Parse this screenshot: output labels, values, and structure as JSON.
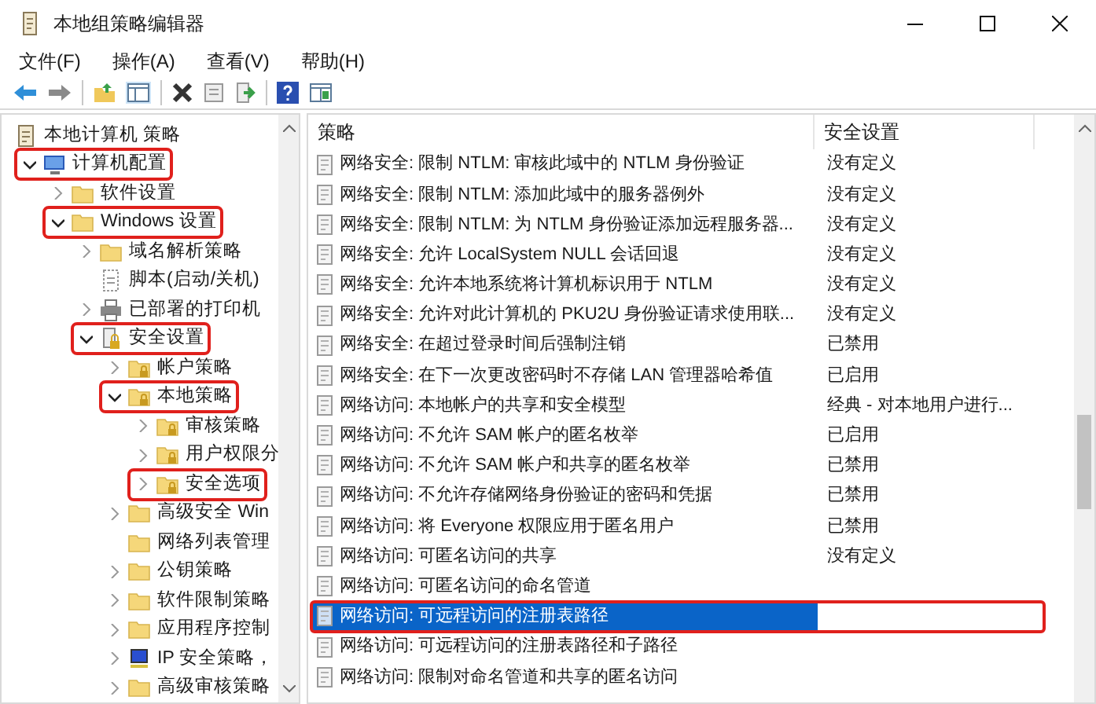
{
  "window": {
    "title": "本地组策略编辑器"
  },
  "menu": [
    "文件(F)",
    "操作(A)",
    "查看(V)",
    "帮助(H)"
  ],
  "tree": [
    {
      "label": "本地计算机 策略",
      "kind": "policy",
      "highlighted": false,
      "children": [
        {
          "label": "计算机配置",
          "kind": "computer",
          "expanded": true,
          "highlighted": true,
          "children": [
            {
              "label": "软件设置",
              "kind": "folder",
              "expanded": false,
              "highlighted": false
            },
            {
              "label": "Windows 设置",
              "kind": "folder",
              "expanded": true,
              "highlighted": true,
              "children": [
                {
                  "label": "域名解析策略",
                  "kind": "folder",
                  "expanded": false,
                  "highlighted": false
                },
                {
                  "label": "脚本(启动/关机)",
                  "kind": "script",
                  "highlighted": false
                },
                {
                  "label": "已部署的打印机",
                  "kind": "printer",
                  "expanded": false,
                  "highlighted": false
                },
                {
                  "label": "安全设置",
                  "kind": "secure",
                  "expanded": true,
                  "highlighted": true,
                  "children": [
                    {
                      "label": "帐户策略",
                      "kind": "secure-folder",
                      "expanded": false,
                      "highlighted": false
                    },
                    {
                      "label": "本地策略",
                      "kind": "secure-folder",
                      "expanded": true,
                      "highlighted": true,
                      "children": [
                        {
                          "label": "审核策略",
                          "kind": "secure-folder",
                          "expanded": false,
                          "highlighted": false
                        },
                        {
                          "label": "用户权限分",
                          "kind": "secure-folder",
                          "expanded": false,
                          "highlighted": false
                        },
                        {
                          "label": "安全选项",
                          "kind": "secure-folder",
                          "expanded": false,
                          "highlighted": true
                        }
                      ]
                    },
                    {
                      "label": "高级安全 Win",
                      "kind": "folder",
                      "expanded": false,
                      "highlighted": false
                    },
                    {
                      "label": "网络列表管理",
                      "kind": "folder",
                      "highlighted": false
                    },
                    {
                      "label": "公钥策略",
                      "kind": "folder",
                      "expanded": false,
                      "highlighted": false
                    },
                    {
                      "label": "软件限制策略",
                      "kind": "folder",
                      "expanded": false,
                      "highlighted": false
                    },
                    {
                      "label": "应用程序控制",
                      "kind": "folder",
                      "expanded": false,
                      "highlighted": false
                    },
                    {
                      "label": "IP 安全策略，",
                      "kind": "network",
                      "expanded": false,
                      "highlighted": false
                    },
                    {
                      "label": "高级审核策略",
                      "kind": "folder",
                      "expanded": false,
                      "highlighted": false
                    }
                  ]
                }
              ]
            }
          ]
        }
      ]
    }
  ],
  "table": {
    "columns": [
      "策略",
      "安全设置"
    ],
    "rows": [
      {
        "policy": "网络安全: 限制 NTLM: 审核此域中的 NTLM 身份验证",
        "setting": "没有定义",
        "selected": false,
        "highlighted": false
      },
      {
        "policy": "网络安全: 限制 NTLM: 添加此域中的服务器例外",
        "setting": "没有定义",
        "selected": false,
        "highlighted": false
      },
      {
        "policy": "网络安全: 限制 NTLM: 为 NTLM 身份验证添加远程服务器...",
        "setting": "没有定义",
        "selected": false,
        "highlighted": false
      },
      {
        "policy": "网络安全: 允许 LocalSystem NULL 会话回退",
        "setting": "没有定义",
        "selected": false,
        "highlighted": false
      },
      {
        "policy": "网络安全: 允许本地系统将计算机标识用于 NTLM",
        "setting": "没有定义",
        "selected": false,
        "highlighted": false
      },
      {
        "policy": "网络安全: 允许对此计算机的 PKU2U 身份验证请求使用联...",
        "setting": "没有定义",
        "selected": false,
        "highlighted": false
      },
      {
        "policy": "网络安全: 在超过登录时间后强制注销",
        "setting": "已禁用",
        "selected": false,
        "highlighted": false
      },
      {
        "policy": "网络安全: 在下一次更改密码时不存储 LAN 管理器哈希值",
        "setting": "已启用",
        "selected": false,
        "highlighted": false
      },
      {
        "policy": "网络访问: 本地帐户的共享和安全模型",
        "setting": "经典 - 对本地用户进行...",
        "selected": false,
        "highlighted": false
      },
      {
        "policy": "网络访问: 不允许 SAM 帐户的匿名枚举",
        "setting": "已启用",
        "selected": false,
        "highlighted": false
      },
      {
        "policy": "网络访问: 不允许 SAM 帐户和共享的匿名枚举",
        "setting": "已禁用",
        "selected": false,
        "highlighted": false
      },
      {
        "policy": "网络访问: 不允许存储网络身份验证的密码和凭据",
        "setting": "已禁用",
        "selected": false,
        "highlighted": false
      },
      {
        "policy": "网络访问: 将 Everyone 权限应用于匿名用户",
        "setting": "已禁用",
        "selected": false,
        "highlighted": false
      },
      {
        "policy": "网络访问: 可匿名访问的共享",
        "setting": "没有定义",
        "selected": false,
        "highlighted": false
      },
      {
        "policy": "网络访问: 可匿名访问的命名管道",
        "selected": false,
        "highlighted": false
      },
      {
        "policy": "网络访问: 可远程访问的注册表路径",
        "selected": true,
        "highlighted": true
      },
      {
        "policy": "网络访问: 可远程访问的注册表路径和子路径",
        "selected": false,
        "highlighted": false
      },
      {
        "policy": "网络访问: 限制对命名管道和共享的匿名访问",
        "selected": false,
        "highlighted": false
      }
    ]
  }
}
